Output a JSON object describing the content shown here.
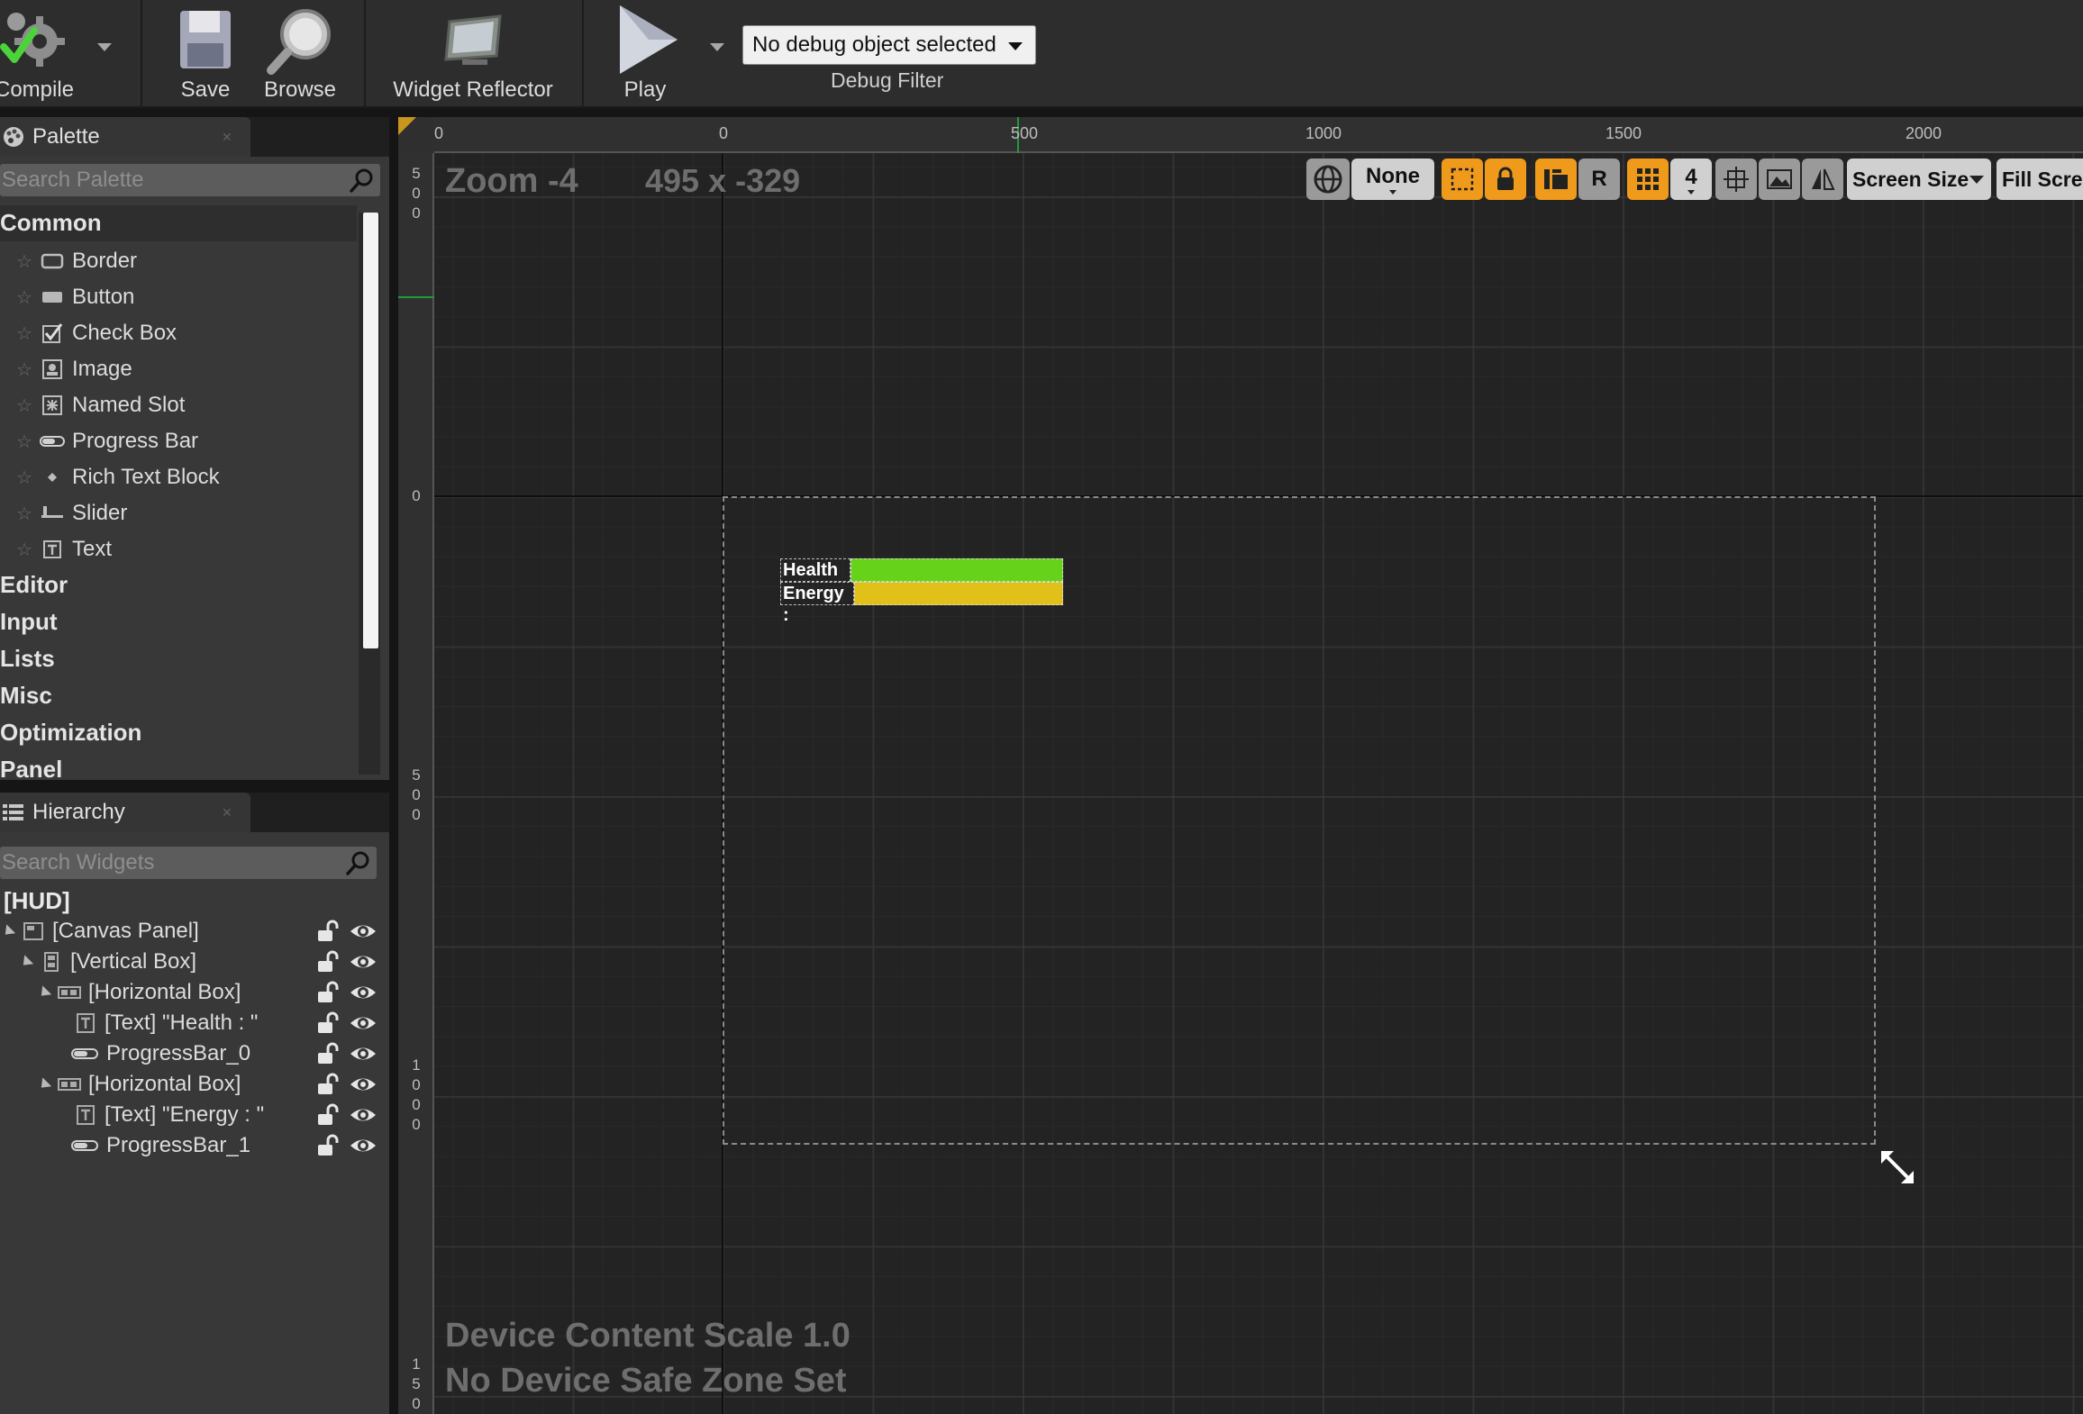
{
  "toolbar": {
    "compile_label": "Compile",
    "save_label": "Save",
    "browse_label": "Browse",
    "widget_reflector_label": "Widget Reflector",
    "play_label": "Play",
    "debug_select_value": "No debug object selected",
    "debug_filter_label": "Debug Filter"
  },
  "palette": {
    "tab_label": "Palette",
    "search_placeholder": "Search Palette",
    "categories": [
      "Common",
      "Editor",
      "Input",
      "Lists",
      "Misc",
      "Optimization",
      "Panel"
    ],
    "common_items": [
      {
        "label": "Border",
        "icon": "border-icon"
      },
      {
        "label": "Button",
        "icon": "button-icon"
      },
      {
        "label": "Check Box",
        "icon": "checkbox-icon"
      },
      {
        "label": "Image",
        "icon": "image-icon"
      },
      {
        "label": "Named Slot",
        "icon": "named-slot-icon"
      },
      {
        "label": "Progress Bar",
        "icon": "progress-bar-icon"
      },
      {
        "label": "Rich Text Block",
        "icon": "rich-text-icon"
      },
      {
        "label": "Slider",
        "icon": "slider-icon"
      },
      {
        "label": "Text",
        "icon": "text-icon"
      }
    ]
  },
  "hierarchy": {
    "tab_label": "Hierarchy",
    "search_placeholder": "Search Widgets",
    "root": "[HUD]",
    "items": [
      {
        "label": "[Canvas Panel]",
        "depth": 0,
        "expandable": true,
        "icon": "canvas-panel-icon"
      },
      {
        "label": "[Vertical Box]",
        "depth": 1,
        "expandable": true,
        "icon": "vertical-box-icon"
      },
      {
        "label": "[Horizontal Box]",
        "depth": 2,
        "expandable": true,
        "icon": "horizontal-box-icon"
      },
      {
        "label": "[Text] \"Health : \"",
        "depth": 3,
        "expandable": false,
        "icon": "text-icon"
      },
      {
        "label": "ProgressBar_0",
        "depth": 3,
        "expandable": false,
        "icon": "progress-bar-icon"
      },
      {
        "label": "[Horizontal Box]",
        "depth": 2,
        "expandable": true,
        "icon": "horizontal-box-icon"
      },
      {
        "label": "[Text] \"Energy : \"",
        "depth": 3,
        "expandable": false,
        "icon": "text-icon"
      },
      {
        "label": "ProgressBar_1",
        "depth": 3,
        "expandable": false,
        "icon": "progress-bar-icon"
      }
    ]
  },
  "designer": {
    "zoom_label": "Zoom -4",
    "cursor_coords": "495 x -329",
    "ruler_top": [
      "0",
      "0",
      "500",
      "1000",
      "1500",
      "2000"
    ],
    "ruler_left": [
      [
        "5",
        "0",
        "0"
      ],
      [
        "0"
      ],
      [
        "5",
        "0",
        "0"
      ],
      [
        "1",
        "0",
        "0",
        "0"
      ],
      [
        "1",
        "5",
        "0"
      ]
    ],
    "device_scale": "Device Content Scale 1.0",
    "safe_zone": "No Device Safe Zone Set",
    "health_label": "Health :",
    "energy_label": "Energy :",
    "health_color": "#66d31a",
    "energy_color": "#e2c01a",
    "health_percent": 100,
    "energy_percent": 100
  },
  "viewport_toolbar": {
    "none_label": "None",
    "r_label": "R",
    "grid_value": "4",
    "screen_size_label": "Screen Size",
    "fill_screen_label": "Fill Scree"
  },
  "colors": {
    "accent_orange": "#f09a1c"
  }
}
